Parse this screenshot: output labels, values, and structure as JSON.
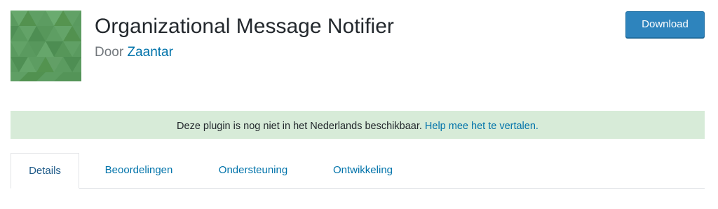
{
  "plugin": {
    "title": "Organizational Message Notifier",
    "byline_prefix": "Door",
    "author": "Zaantar",
    "icon_name": "plugin-banner-icon"
  },
  "actions": {
    "download_label": "Download"
  },
  "notice": {
    "text": "Deze plugin is nog niet in het Nederlands beschikbaar.",
    "link_text": "Help mee het te vertalen."
  },
  "tabs": [
    {
      "label": "Details",
      "active": true
    },
    {
      "label": "Beoordelingen",
      "active": false
    },
    {
      "label": "Ondersteuning",
      "active": false
    },
    {
      "label": "Ontwikkeling",
      "active": false
    }
  ],
  "colors": {
    "accent": "#0073aa",
    "button": "#2e84bd",
    "notice_bg": "#d7ebd8",
    "icon_green": "#5a9a5f"
  }
}
